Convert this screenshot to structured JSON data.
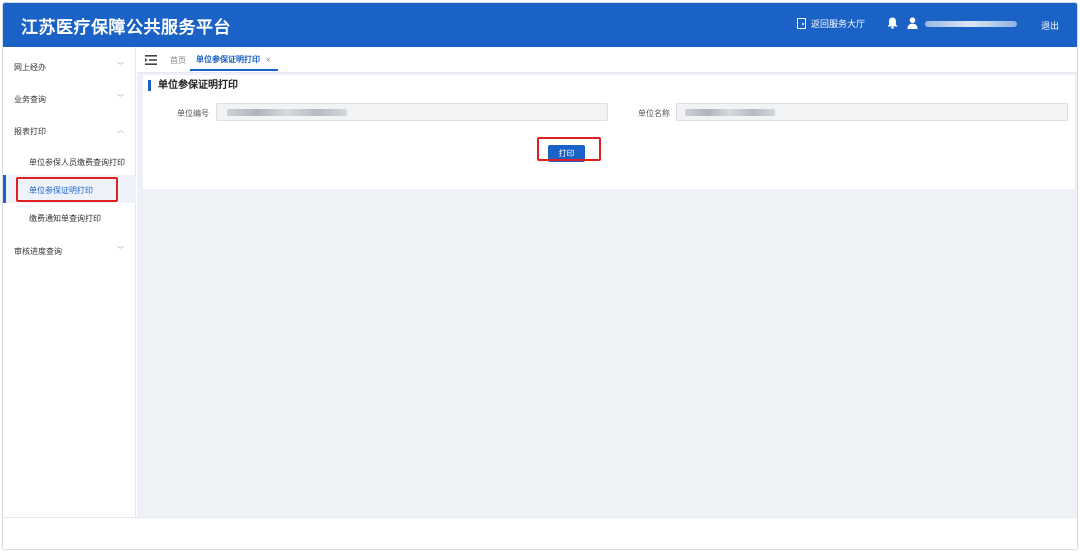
{
  "header": {
    "title": "江苏医疗保障公共服务平台",
    "return_label": "返回服务大厅",
    "logout_label": "退出",
    "bg_color": "#1a62c6"
  },
  "sidebar": {
    "items": [
      {
        "label": "网上经办",
        "chevron": "chevron-down"
      },
      {
        "label": "业务查询",
        "chevron": "chevron-down"
      },
      {
        "label": "报表打印",
        "chevron": "chevron-up"
      },
      {
        "label": "审核进度查询",
        "chevron": "chevron-down"
      }
    ],
    "sub_items": [
      {
        "label": "单位参保人员缴费查询打印"
      },
      {
        "label": "单位参保证明打印",
        "active": true
      },
      {
        "label": "缴费通知单查询打印"
      }
    ]
  },
  "tabs": {
    "home_label": "首页",
    "active_label": "单位参保证明打印",
    "close_glyph": "×"
  },
  "panel": {
    "title": "单位参保证明打印",
    "fields": [
      {
        "label": "单位编号",
        "value": ""
      },
      {
        "label": "单位名称",
        "value": ""
      }
    ],
    "print_label": "打印"
  },
  "colors": {
    "accent": "#1a62c6",
    "highlight": "#e02020",
    "content_bg": "#eef1f5"
  }
}
